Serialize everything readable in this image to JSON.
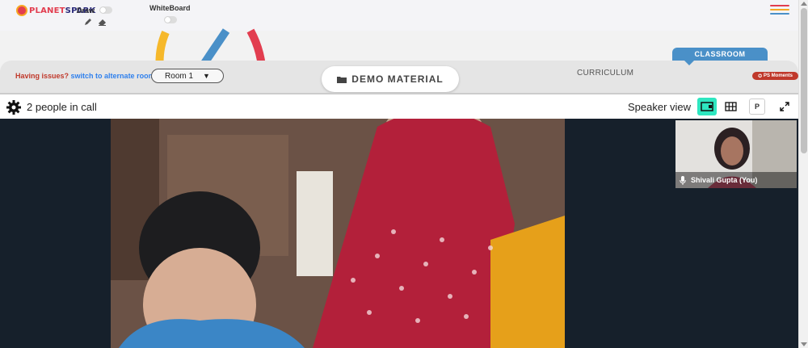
{
  "brand": {
    "logo_text_a": "PLANET",
    "logo_text_b": "SPARK"
  },
  "tools": {
    "draw_label": "Draw",
    "whiteboard_label": "WhiteBoard"
  },
  "header": {
    "issues_text": "Having issues?",
    "switch_link": "switch to alternate room",
    "room_value": "Room 1",
    "demo_material": "DEMO MATERIAL",
    "curriculum": "CURRICULUM",
    "classroom": "CLASSROOM",
    "ps_moments": "PS Moments"
  },
  "call": {
    "people_count": "2 people in call",
    "view_label": "Speaker view",
    "p_label": "P"
  },
  "participants": [
    {
      "name": "Shivali Gupta (You)"
    }
  ],
  "icons": {
    "settings": "gear-icon",
    "speaker_view": "speaker-view-icon",
    "grid_view": "grid-icon",
    "expand": "expand-icon",
    "folder": "folder-icon",
    "menu": "hamburger-menu-icon",
    "microphone": "microphone-icon"
  },
  "colors": {
    "accent_teal": "#2ee6c0",
    "classroom_blue": "#4a90c8",
    "ps_red": "#c0392b",
    "issues_red": "#c0392b",
    "link_blue": "#2f80ed"
  }
}
